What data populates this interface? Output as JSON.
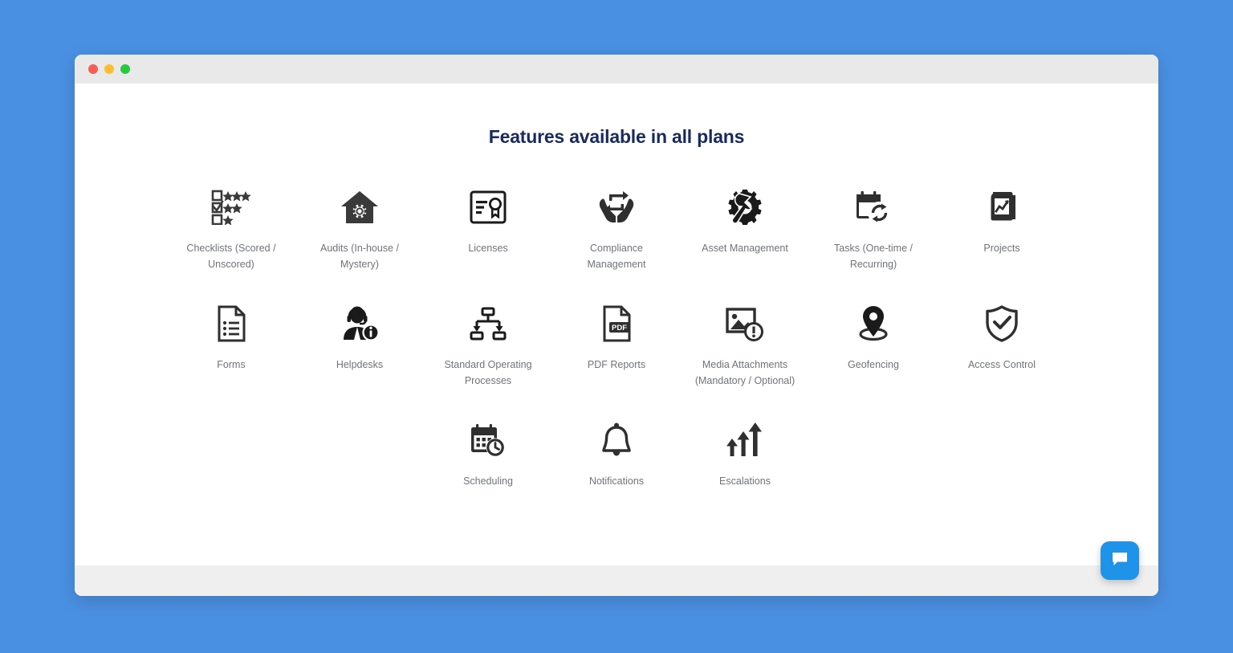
{
  "window": {
    "traffic_lights": [
      {
        "name": "close-button",
        "color": "#f35f57"
      },
      {
        "name": "minimize-button",
        "color": "#fcbd2e"
      },
      {
        "name": "maximize-button",
        "color": "#29c841"
      }
    ]
  },
  "page": {
    "title": "Features available in all plans",
    "background_color": "#4a90e2",
    "title_color": "#1b2a5e",
    "label_color": "#6f7479"
  },
  "features": [
    {
      "icon": "checklist-stars-icon",
      "label": "Checklists (Scored / Unscored)"
    },
    {
      "icon": "house-gear-icon",
      "label": "Audits (In-house / Mystery)"
    },
    {
      "icon": "certificate-icon",
      "label": "Licenses"
    },
    {
      "icon": "hands-recycle-icon",
      "label": "Compliance Management"
    },
    {
      "icon": "gear-wrench-icon",
      "label": "Asset Management"
    },
    {
      "icon": "calendar-refresh-icon",
      "label": "Tasks (One-time / Recurring)"
    },
    {
      "icon": "projects-chart-icon",
      "label": "Projects"
    },
    {
      "icon": "document-list-icon",
      "label": "Forms"
    },
    {
      "icon": "support-agent-info-icon",
      "label": "Helpdesks"
    },
    {
      "icon": "hierarchy-flow-icon",
      "label": "Standard Operating Processes"
    },
    {
      "icon": "pdf-file-icon",
      "label": "PDF Reports"
    },
    {
      "icon": "image-alert-icon",
      "label": "Media Attachments (Mandatory / Optional)"
    },
    {
      "icon": "map-pin-icon",
      "label": "Geofencing"
    },
    {
      "icon": "shield-check-icon",
      "label": "Access Control"
    },
    {
      "icon": "calendar-clock-icon",
      "label": "Scheduling"
    },
    {
      "icon": "bell-icon",
      "label": "Notifications"
    },
    {
      "icon": "arrows-up-icon",
      "label": "Escalations"
    }
  ],
  "chat_widget": {
    "icon": "chat-bubble-icon",
    "color": "#1f93e8"
  }
}
